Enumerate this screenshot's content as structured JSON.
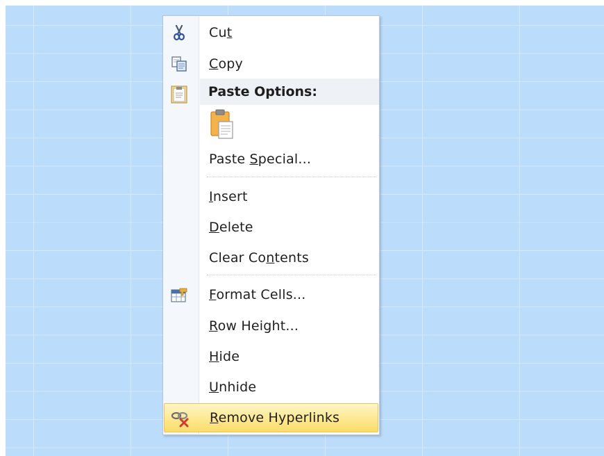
{
  "menu": {
    "cut": {
      "pre": "Cu",
      "key": "t",
      "post": ""
    },
    "copy": {
      "pre": "",
      "key": "C",
      "post": "opy"
    },
    "paste_options": "Paste Options:",
    "paste_special": {
      "pre": "Paste ",
      "key": "S",
      "post": "pecial..."
    },
    "insert": {
      "pre": "",
      "key": "I",
      "post": "nsert"
    },
    "delete": {
      "pre": "",
      "key": "D",
      "post": "elete"
    },
    "clear_contents": {
      "pre": "Clear Co",
      "key": "n",
      "post": "tents"
    },
    "format_cells": {
      "pre": "",
      "key": "F",
      "post": "ormat Cells..."
    },
    "row_height": {
      "pre": "",
      "key": "R",
      "post": "ow Height..."
    },
    "hide": {
      "pre": "",
      "key": "H",
      "post": "ide"
    },
    "unhide": {
      "pre": "",
      "key": "U",
      "post": "nhide"
    },
    "remove_hyperlinks": {
      "pre": "",
      "key": "R",
      "post": "emove Hyperlinks"
    }
  },
  "icons": {
    "cut": "scissors-icon",
    "copy": "copy-icon",
    "paste_options": "clipboard-icon",
    "paste": "paste-icon",
    "format_cells": "format-cells-icon",
    "remove_hyperlinks": "remove-hyperlink-icon"
  },
  "colors": {
    "sheet_background": "#bcdcfb",
    "highlight": "#fde88f",
    "highlight_border": "#e8c45c"
  }
}
